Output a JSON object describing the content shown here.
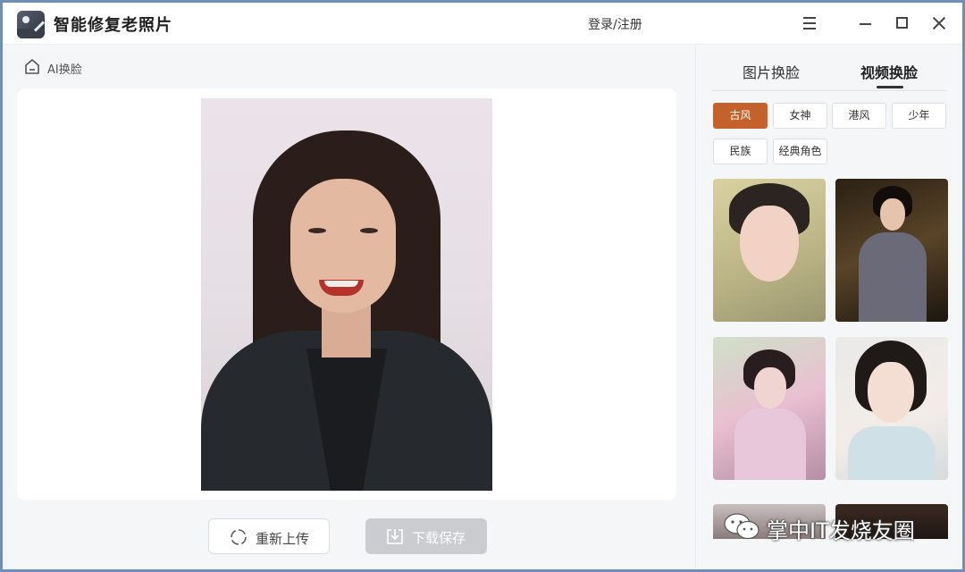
{
  "app": {
    "title": "智能修复老照片",
    "login_label": "登录/注册",
    "icons": {
      "logo": "app-logo-icon",
      "menu": "menu-icon",
      "minimize": "minimize-icon",
      "maximize": "maximize-icon",
      "close": "close-icon"
    }
  },
  "breadcrumb": {
    "label": "AI换脸",
    "icon": "home-icon"
  },
  "actions": {
    "reupload_label": "重新上传",
    "download_label": "下载保存",
    "reupload_icon": "refresh-icon",
    "download_icon": "download-icon"
  },
  "sidebar": {
    "tabs": [
      {
        "label": "图片换脸",
        "active": false
      },
      {
        "label": "视频换脸",
        "active": true
      }
    ],
    "categories": [
      {
        "label": "古风",
        "active": true
      },
      {
        "label": "女神",
        "active": false
      },
      {
        "label": "港风",
        "active": false
      },
      {
        "label": "少年",
        "active": false
      },
      {
        "label": "民族",
        "active": false
      },
      {
        "label": "经典角色",
        "active": false
      }
    ],
    "templates_count_visible": 6
  },
  "watermark": {
    "text": "掌中IT发烧友圈",
    "icon": "wechat-icon"
  },
  "colors": {
    "accent": "#c5622c",
    "download_disabled": "#cbcccf",
    "window_border": "#6e8fb8"
  }
}
